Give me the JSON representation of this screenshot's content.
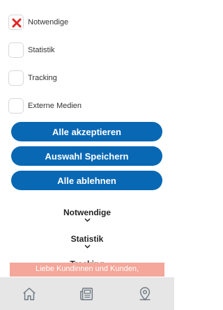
{
  "consent": {
    "options": [
      {
        "label": "Notwendige",
        "checked": true
      },
      {
        "label": "Statistik",
        "checked": false
      },
      {
        "label": "Tracking",
        "checked": false
      },
      {
        "label": "Externe Medien",
        "checked": false
      }
    ],
    "buttons": {
      "accept_all": "Alle akzeptieren",
      "save_selection": "Auswahl Speichern",
      "reject_all": "Alle ablehnen"
    },
    "sections": [
      {
        "title": "Notwendige"
      },
      {
        "title": "Statistik"
      },
      {
        "title": "Tracking"
      }
    ]
  },
  "banner": {
    "text": "Liebe Kundinnen und Kunden,"
  },
  "bottom_nav": {
    "items": [
      {
        "icon": "home-icon"
      },
      {
        "icon": "newspaper-icon"
      },
      {
        "icon": "location-pin-icon"
      }
    ]
  },
  "colors": {
    "primary": "#0868b4",
    "check_mark": "#e32424",
    "banner": "#f4a79a",
    "nav_bg": "#e6e6e6"
  }
}
